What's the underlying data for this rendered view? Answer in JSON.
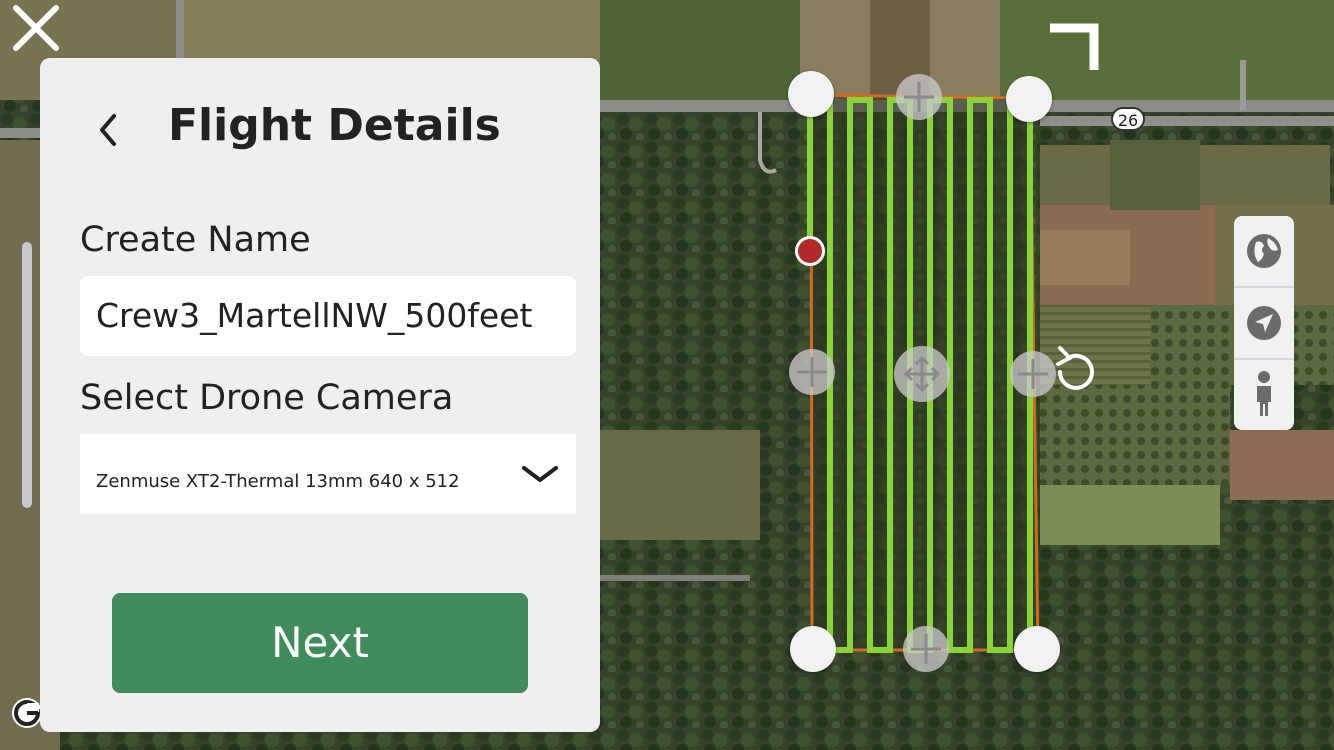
{
  "panel": {
    "title": "Flight Details",
    "name_label": "Create Name",
    "name_value": "Crew3_MartellNW_500feet",
    "camera_label": "Select Drone Camera",
    "camera_value": "Zenmuse XT2-Thermal 13mm 640 x 512",
    "next_label": "Next"
  },
  "map": {
    "road_shield": "26",
    "route_color": "#8ad43a",
    "boundary_color": "#d46a1c",
    "start_color": "#b02a2a"
  },
  "controls": {
    "icons": [
      "globe-icon",
      "navigation-arrow-icon",
      "person-icon"
    ]
  },
  "colors": {
    "accent_green": "#3f8c5a",
    "panel_bg": "#efeff1"
  }
}
